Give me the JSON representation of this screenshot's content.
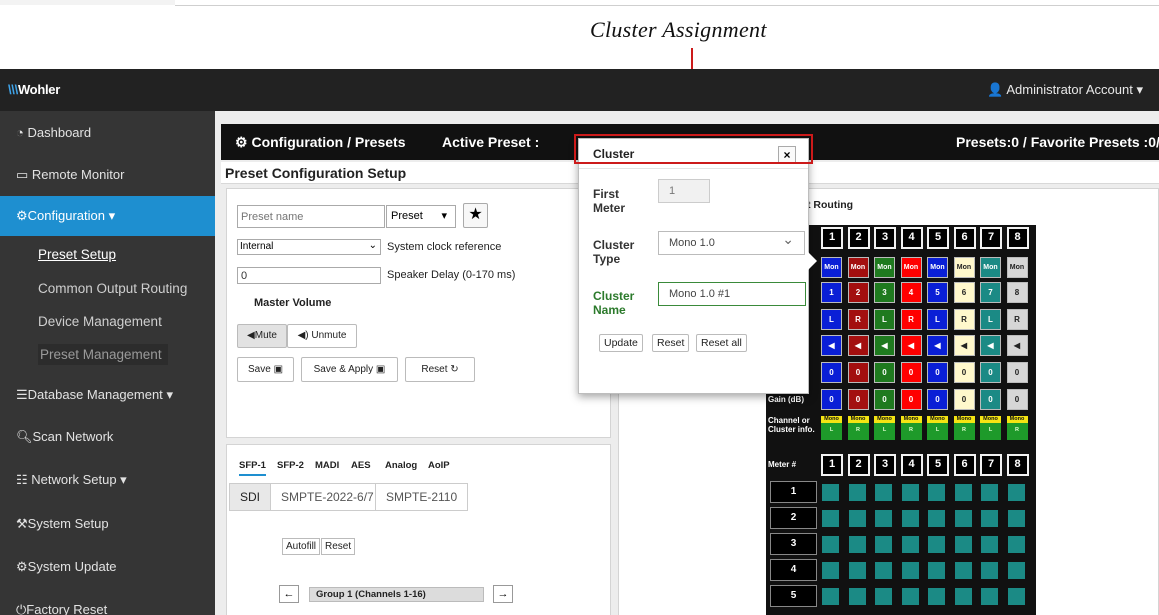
{
  "annotation": {
    "title": "Cluster Assignment"
  },
  "brand": {
    "logo": "Wohler"
  },
  "account": {
    "label": "Administrator Account"
  },
  "sidebar": {
    "items": [
      {
        "label": "Dashboard",
        "icon": "dashboard-icon"
      },
      {
        "label": "Remote Monitor",
        "icon": "monitor-icon"
      },
      {
        "label": "Configuration",
        "icon": "cogs-icon"
      },
      {
        "label": "Database Management",
        "icon": "database-icon"
      },
      {
        "label": "Scan Network",
        "icon": "search-icon"
      },
      {
        "label": "Network Setup",
        "icon": "sitemap-icon"
      },
      {
        "label": "System Setup",
        "icon": "wrench-icon"
      },
      {
        "label": "System Update",
        "icon": "gear-icon"
      },
      {
        "label": "Factory Reset",
        "icon": "power-icon"
      }
    ],
    "config_sub": [
      "Preset Setup",
      "Common Output Routing",
      "Device Management",
      "Preset Management"
    ]
  },
  "header": {
    "crumb": "Configuration / Presets",
    "active_preset": "Active Preset :",
    "presets_count": "Presets:0 / Favorite Presets :0/8"
  },
  "subheader": {
    "title": "Preset Configuration Setup"
  },
  "preset": {
    "name_placeholder": "Preset name",
    "type_value": "Preset",
    "clock_value": "Internal",
    "clock_label": "System clock reference",
    "delay_value": "0",
    "delay_label": "Speaker Delay (0-170 ms)",
    "master_volume": "Master Volume",
    "mute": "Mute",
    "unmute": "Unmute",
    "save": "Save",
    "save_apply": "Save & Apply",
    "reset": "Reset"
  },
  "io": {
    "tabs": [
      "SFP-1",
      "SFP-2",
      "MADI",
      "AES",
      "Analog",
      "AoIP"
    ],
    "pills": [
      "SDI",
      "SMPTE-2022-6/7",
      "SMPTE-2110"
    ],
    "autofill": "Autofill",
    "reset": "Reset",
    "group": "Group 1 (Channels 1-16)",
    "prev": "←",
    "next": "→"
  },
  "routing": {
    "tab_label": "t Routing",
    "headers": [
      "1",
      "2",
      "3",
      "4",
      "5",
      "6",
      "7",
      "8"
    ],
    "mono_label": "Mon",
    "mono_colors": [
      "#0a1fd6",
      "#a30f0f",
      "#1f7a1f",
      "#ff0000",
      "#0a1fd6",
      "#fff8cc",
      "#1b8a85",
      "#d6d6d6"
    ],
    "lr": [
      "L",
      "R",
      "L",
      "R",
      "L",
      "R",
      "L",
      "R"
    ],
    "gain_label": "Gain (dB)",
    "gain_value": "0",
    "chan_label": "Channel or Cluster info.",
    "chan_mono": "Mono",
    "meter_label": "Meter #",
    "meter_rows": [
      "1",
      "2",
      "3",
      "4",
      "5"
    ]
  },
  "popup": {
    "title": "Cluster",
    "close": "×",
    "first_meter_label": "First Meter",
    "first_meter_value": "1",
    "type_label": "Cluster Type",
    "type_value": "Mono 1.0",
    "name_label": "Cluster Name",
    "name_value": "Mono 1.0 #1",
    "update": "Update",
    "reset": "Reset",
    "reset_all": "Reset all"
  },
  "colors": {
    "sidebar_bg": "#353535",
    "topbar_bg": "#222222",
    "accent": "#1e8fd0",
    "annotation_red": "#cc1a1a"
  }
}
